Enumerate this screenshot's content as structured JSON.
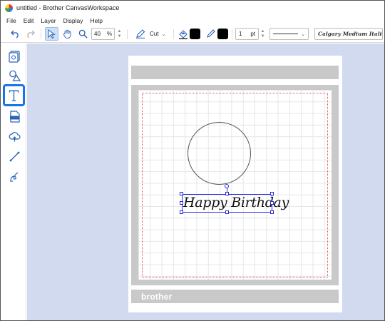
{
  "window": {
    "title": "untitled - Brother CanvasWorkspace"
  },
  "menu": {
    "items": [
      "File",
      "Edit",
      "Layer",
      "Display",
      "Help"
    ]
  },
  "toolbar": {
    "zoom_value": "40",
    "zoom_unit": "%",
    "mode": "Cut",
    "line_width": "1",
    "line_unit": "pt",
    "font_name": "Calgary Medium Italic",
    "fill_color": "#000000",
    "line_color": "#000000"
  },
  "icons": {
    "undo": "undo-icon",
    "redo": "redo-icon",
    "select": "select-icon",
    "pan": "hand-icon",
    "zoom": "magnifier-icon",
    "pen": "pen-icon",
    "fill": "paint-bucket-icon",
    "line": "pencil-icon"
  },
  "sidebar": {
    "items": [
      {
        "name": "template",
        "active": false
      },
      {
        "name": "shapes",
        "active": false
      },
      {
        "name": "text",
        "active": true
      },
      {
        "name": "svg-import",
        "active": false
      },
      {
        "name": "cloud",
        "active": false
      },
      {
        "name": "line",
        "active": false
      },
      {
        "name": "freehand",
        "active": false
      }
    ]
  },
  "canvas": {
    "mat_brand": "brother",
    "text_object": "Happy Birthday",
    "accent_color": "#1a73e8",
    "selection_color": "#2a2ad8",
    "cut_area_color": "#d9534f"
  }
}
